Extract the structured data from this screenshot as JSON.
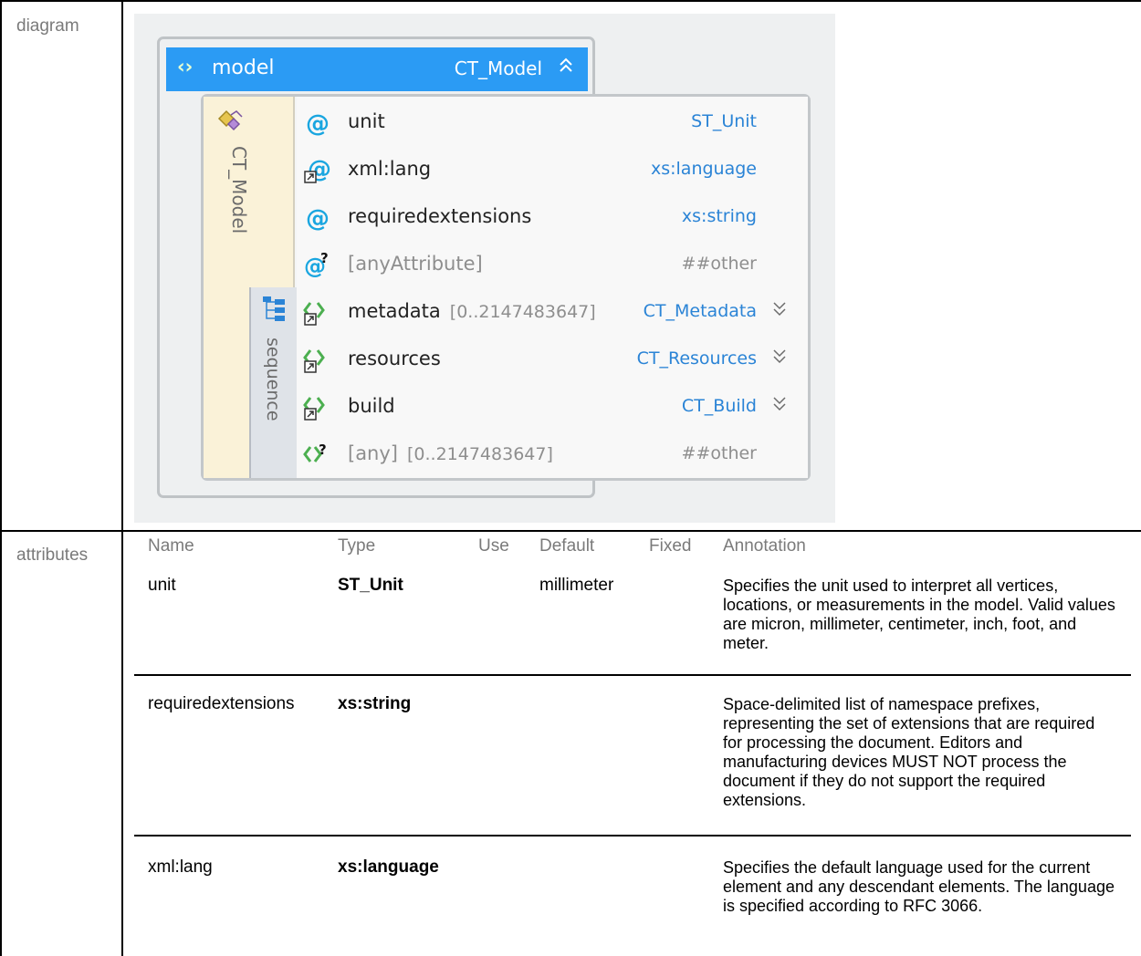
{
  "labels": {
    "diagram": "diagram",
    "attributes": "attributes"
  },
  "diagram": {
    "element": {
      "name": "model",
      "type": "CT_Model"
    },
    "complex_type": "CT_Model",
    "compositor": "sequence",
    "rows": [
      {
        "icon": "attribute-icon",
        "name": "unit",
        "occurs": "",
        "type": "ST_Unit",
        "expandable": false,
        "optional": false
      },
      {
        "icon": "attribute-ref-icon",
        "name": "xml:lang",
        "occurs": "",
        "type": "xs:language",
        "expandable": false,
        "optional": false
      },
      {
        "icon": "attribute-icon",
        "name": "requiredextensions",
        "occurs": "",
        "type": "xs:string",
        "expandable": false,
        "optional": false
      },
      {
        "icon": "any-attribute-icon",
        "name": "[anyAttribute]",
        "occurs": "",
        "type": "##other",
        "expandable": false,
        "optional": true
      },
      {
        "icon": "element-ref-icon",
        "name": "metadata",
        "occurs": "[0..2147483647]",
        "type": "CT_Metadata",
        "expandable": true,
        "optional": false
      },
      {
        "icon": "element-ref-icon",
        "name": "resources",
        "occurs": "",
        "type": "CT_Resources",
        "expandable": true,
        "optional": false
      },
      {
        "icon": "element-ref-icon",
        "name": "build",
        "occurs": "",
        "type": "CT_Build",
        "expandable": true,
        "optional": false
      },
      {
        "icon": "any-element-icon",
        "name": "[any]",
        "occurs": "[0..2147483647]",
        "type": "##other",
        "expandable": false,
        "optional": true
      }
    ]
  },
  "attributes": {
    "headers": [
      "Name",
      "Type",
      "Use",
      "Default",
      "Fixed",
      "Annotation"
    ],
    "rows": [
      {
        "name": "unit",
        "type": "ST_Unit",
        "use": "",
        "default": "millimeter",
        "fixed": "",
        "annotation": "Specifies the unit used to interpret all vertices, locations, or measurements in the model. Valid values are micron, millimeter, centimeter, inch, foot, and meter."
      },
      {
        "name": "requiredextensions",
        "type": "xs:string",
        "use": "",
        "default": "",
        "fixed": "",
        "annotation": "Space-delimited list of namespace prefixes, representing the set of extensions that are required for processing the document. Editors and manufacturing devices MUST NOT process the document if they do not support the required extensions."
      },
      {
        "name": "xml:lang",
        "type": "xs:language",
        "use": "",
        "default": "",
        "fixed": "",
        "annotation": "Specifies the default language used for the current element and any descendant elements. The language is specified according to RFC 3066."
      }
    ]
  }
}
